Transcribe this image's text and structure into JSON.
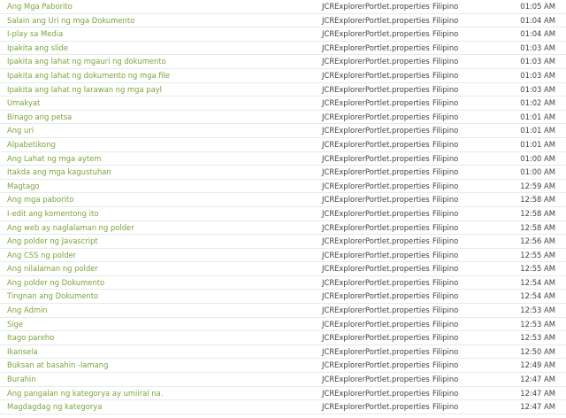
{
  "colors": {
    "link": "#7aa43b",
    "text": "#444444",
    "row_divider": "#e9e9e9"
  },
  "rows": [
    {
      "message": "Ang Mga Paborito",
      "file": "JCRExplorerPortlet.properties",
      "language": "Filipino",
      "time": "01:05 AM"
    },
    {
      "message": "Salain ang Uri ng mga Dokumento",
      "file": "JCRExplorerPortlet.properties",
      "language": "Filipino",
      "time": "01:04 AM"
    },
    {
      "message": "I-play sa Media",
      "file": "JCRExplorerPortlet.properties",
      "language": "Filipino",
      "time": "01:04 AM"
    },
    {
      "message": "Ipakita ang slide",
      "file": "JCRExplorerPortlet.properties",
      "language": "Filipino",
      "time": "01:03 AM"
    },
    {
      "message": "Ipakita ang lahat ng mgauri ng dokumento",
      "file": "JCRExplorerPortlet.properties",
      "language": "Filipino",
      "time": "01:03 AM"
    },
    {
      "message": "Ipakita ang lahat ng dokumento ng mga file",
      "file": "JCRExplorerPortlet.properties",
      "language": "Filipino",
      "time": "01:03 AM"
    },
    {
      "message": "Ipakita ang lahat ng larawan ng mga payl",
      "file": "JCRExplorerPortlet.properties",
      "language": "Filipino",
      "time": "01:03 AM"
    },
    {
      "message": "Umakyat",
      "file": "JCRExplorerPortlet.properties",
      "language": "Filipino",
      "time": "01:02 AM"
    },
    {
      "message": "Binago ang petsa",
      "file": "JCRExplorerPortlet.properties",
      "language": "Filipino",
      "time": "01:01 AM"
    },
    {
      "message": "Ang uri",
      "file": "JCRExplorerPortlet.properties",
      "language": "Filipino",
      "time": "01:01 AM"
    },
    {
      "message": "Alpabetikong",
      "file": "JCRExplorerPortlet.properties",
      "language": "Filipino",
      "time": "01:01 AM"
    },
    {
      "message": "Ang Lahat ng mga aytem",
      "file": "JCRExplorerPortlet.properties",
      "language": "Filipino",
      "time": "01:00 AM"
    },
    {
      "message": "Itakda ang mga kagustuhan",
      "file": "JCRExplorerPortlet.properties",
      "language": "Filipino",
      "time": "01:00 AM"
    },
    {
      "message": "Magtago",
      "file": "JCRExplorerPortlet.properties",
      "language": "Filipino",
      "time": "12:59 AM"
    },
    {
      "message": "Ang mga paborito",
      "file": "JCRExplorerPortlet.properties",
      "language": "Filipino",
      "time": "12:58 AM"
    },
    {
      "message": "I-edit ang komentong ito",
      "file": "JCRExplorerPortlet.properties",
      "language": "Filipino",
      "time": "12:58 AM"
    },
    {
      "message": "Ang web ay naglalaman ng polder",
      "file": "JCRExplorerPortlet.properties",
      "language": "Filipino",
      "time": "12:58 AM"
    },
    {
      "message": "Ang polder ng Javascript",
      "file": "JCRExplorerPortlet.properties",
      "language": "Filipino",
      "time": "12:56 AM"
    },
    {
      "message": "Ang CSS ng polder",
      "file": "JCRExplorerPortlet.properties",
      "language": "Filipino",
      "time": "12:55 AM"
    },
    {
      "message": "Ang nilalaman ng polder",
      "file": "JCRExplorerPortlet.properties",
      "language": "Filipino",
      "time": "12:55 AM"
    },
    {
      "message": "Ang polder ng Dokumento",
      "file": "JCRExplorerPortlet.properties",
      "language": "Filipino",
      "time": "12:54 AM"
    },
    {
      "message": "Tingnan ang Dokumento",
      "file": "JCRExplorerPortlet.properties",
      "language": "Filipino",
      "time": "12:54 AM"
    },
    {
      "message": "Ang Admin",
      "file": "JCRExplorerPortlet.properties",
      "language": "Filipino",
      "time": "12:53 AM"
    },
    {
      "message": "Sige",
      "file": "JCRExplorerPortlet.properties",
      "language": "Filipino",
      "time": "12:53 AM"
    },
    {
      "message": "Itago pareho",
      "file": "JCRExplorerPortlet.properties",
      "language": "Filipino",
      "time": "12:53 AM"
    },
    {
      "message": "Ikansela",
      "file": "JCRExplorerPortlet.properties",
      "language": "Filipino",
      "time": "12:50 AM"
    },
    {
      "message": "Buksan at basahin -lamang",
      "file": "JCRExplorerPortlet.properties",
      "language": "Filipino",
      "time": "12:49 AM"
    },
    {
      "message": "Burahin",
      "file": "JCRExplorerPortlet.properties",
      "language": "Filipino",
      "time": "12:47 AM"
    },
    {
      "message": "Ang pangalan ng kategorya ay umiiral na.",
      "file": "JCRExplorerPortlet.properties",
      "language": "Filipino",
      "time": "12:47 AM"
    },
    {
      "message": "Magdagdag ng kategorya",
      "file": "JCRExplorerPortlet.properties",
      "language": "Filipino",
      "time": "12:47 AM"
    }
  ]
}
